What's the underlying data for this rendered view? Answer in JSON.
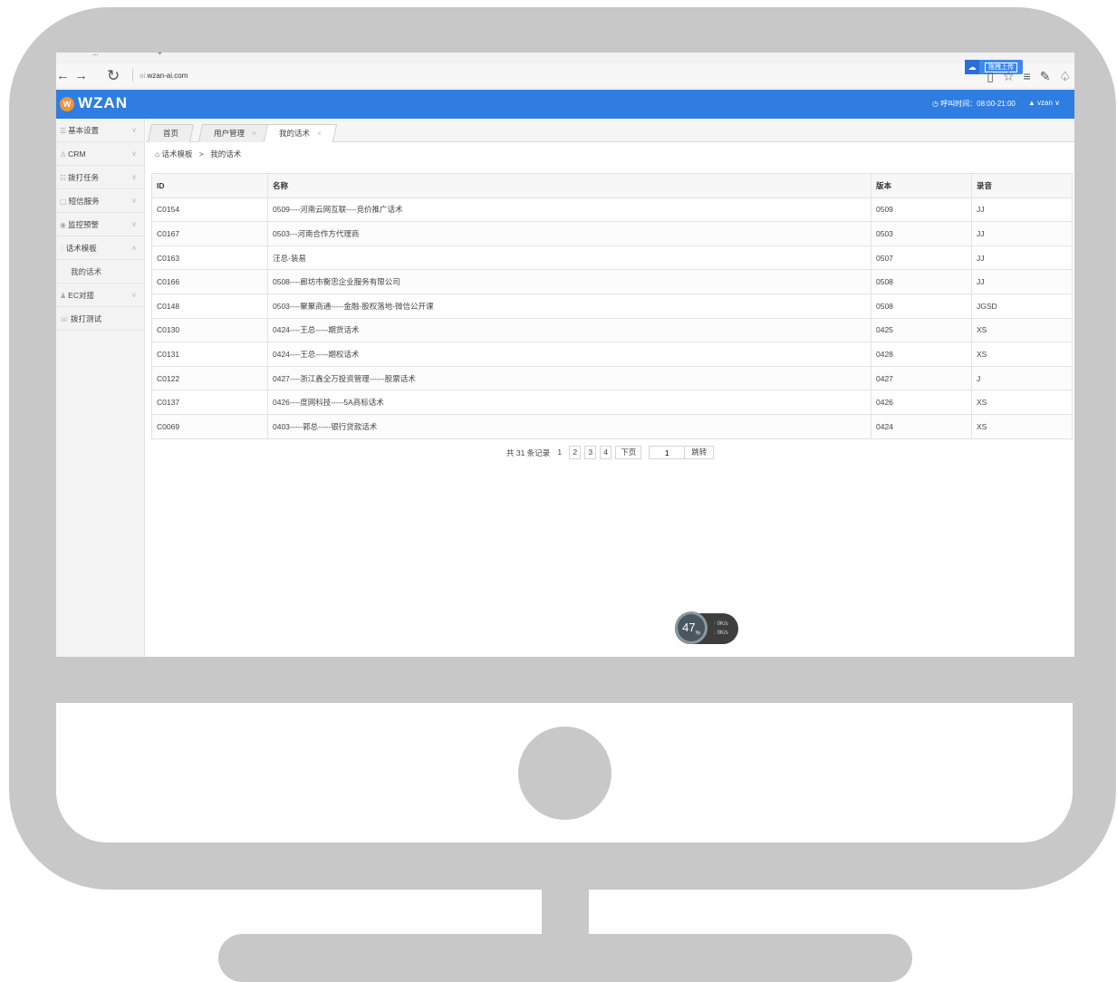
{
  "browser": {
    "tab_title": "...",
    "tab_plus": "+",
    "nav": {
      "back": "←",
      "forward": "→",
      "refresh": "↻"
    },
    "address_prefix": "ai.",
    "address": "wzan-ai.com",
    "upload_label": "拖拽上传"
  },
  "header": {
    "logo_badge": "W",
    "logo_text": "WZAN",
    "hours": "◷ 呼叫时间：08:00-21:00",
    "user": "▲ vzan ∨"
  },
  "sidebar": {
    "items": [
      {
        "label": "基本设置",
        "icon": "☰"
      },
      {
        "label": "CRM",
        "icon": "♙"
      },
      {
        "label": "拨打任务",
        "icon": "☷"
      },
      {
        "label": "短信服务",
        "icon": "▢"
      },
      {
        "label": "监控预警",
        "icon": "◉"
      },
      {
        "label": "话术模板",
        "icon": "◌"
      }
    ],
    "sub_item": "我的话术",
    "items_after": [
      {
        "label": "EC对接",
        "icon": "♟"
      },
      {
        "label": "拨打测试",
        "icon": "☏"
      }
    ]
  },
  "tabs": [
    {
      "label": "首页"
    },
    {
      "label": "用户管理",
      "close": "×"
    },
    {
      "label": "我的话术",
      "close": "×"
    }
  ],
  "breadcrumb": {
    "home_icon": "⌂",
    "parent": "话术模板",
    "separator": ">",
    "current": "我的话术"
  },
  "table": {
    "columns": [
      "ID",
      "名称",
      "版本",
      "录音"
    ],
    "rows": [
      {
        "id": "C0154",
        "name": "0509----河南云网互联----竞价推广话术",
        "version": "0509",
        "recording": "JJ"
      },
      {
        "id": "C0167",
        "name": "0503---河南合作方代理商",
        "version": "0503",
        "recording": "JJ"
      },
      {
        "id": "C0163",
        "name": "汪总-装易",
        "version": "0507",
        "recording": "JJ"
      },
      {
        "id": "C0166",
        "name": "0508----廊坊市衡忠企业服务有限公司",
        "version": "0508",
        "recording": "JJ"
      },
      {
        "id": "C0148",
        "name": "0503----聚聚商通-----金融-股权落地-微信公开课",
        "version": "0508",
        "recording": "JGSD"
      },
      {
        "id": "C0130",
        "name": "0424----王总-----期货话术",
        "version": "0425",
        "recording": "XS"
      },
      {
        "id": "C0131",
        "name": "0424----王总-----期权话术",
        "version": "0428",
        "recording": "XS"
      },
      {
        "id": "C0122",
        "name": "0427----浙江鑫全万投资管理------股票话术",
        "version": "0427",
        "recording": "J"
      },
      {
        "id": "C0137",
        "name": "0426----度网科技-----5A商标话术",
        "version": "0426",
        "recording": "XS"
      },
      {
        "id": "C0069",
        "name": "0403-----郭总-----银行贷款话术",
        "version": "0424",
        "recording": "XS"
      }
    ]
  },
  "pagination": {
    "total": "共 31 条记录",
    "pages": [
      "1",
      "2",
      "3",
      "4"
    ],
    "next": "下页",
    "jump_value": "1",
    "jump_button": "跳转"
  },
  "speed_widget": {
    "percent": "47",
    "percent_unit": "%",
    "up": "0K/s",
    "down": "0K/s"
  }
}
